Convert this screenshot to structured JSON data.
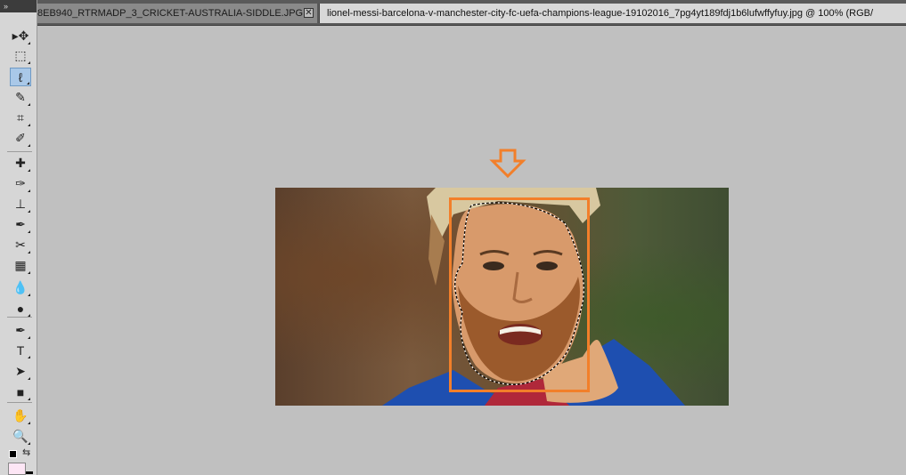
{
  "tabs": [
    {
      "label": "8EB940_RTRMADP_3_CRICKET-AUSTRALIA-SIDDLE.JPG",
      "close_symbol": "✕"
    },
    {
      "label": "lionel-messi-barcelona-v-manchester-city-fc-uefa-champions-league-19102016_7pg4yt189fdj1b6lufwffyfuy.jpg @ 100% (RGB/"
    }
  ],
  "toolbox": {
    "collapse_label": "»",
    "tools": [
      {
        "name": "move-tool",
        "icon": "move-icon",
        "glyph": "▸✥"
      },
      {
        "name": "marquee-tool",
        "icon": "rectangle-marquee-icon",
        "glyph": "⬚"
      },
      {
        "name": "lasso-tool",
        "icon": "lasso-icon",
        "glyph": "ℓ",
        "active": true
      },
      {
        "name": "quick-selection-tool",
        "icon": "quick-selection-icon",
        "glyph": "✎"
      },
      {
        "name": "crop-tool",
        "icon": "crop-icon",
        "glyph": "⌗"
      },
      {
        "name": "eyedropper-tool",
        "icon": "eyedropper-icon",
        "glyph": "✐"
      },
      {
        "name": "healing-brush-tool",
        "icon": "bandage-icon",
        "glyph": "✚"
      },
      {
        "name": "brush-tool",
        "icon": "brush-icon",
        "glyph": "✑"
      },
      {
        "name": "clone-stamp-tool",
        "icon": "stamp-icon",
        "glyph": "⊥"
      },
      {
        "name": "history-brush-tool",
        "icon": "history-brush-icon",
        "glyph": "✒"
      },
      {
        "name": "eraser-tool",
        "icon": "eraser-icon",
        "glyph": "✂"
      },
      {
        "name": "gradient-tool",
        "icon": "gradient-icon",
        "glyph": "▦"
      },
      {
        "name": "blur-tool",
        "icon": "drop-icon",
        "glyph": "💧"
      },
      {
        "name": "dodge-tool",
        "icon": "dodge-icon",
        "glyph": "●"
      },
      {
        "name": "pen-tool",
        "icon": "pen-icon",
        "glyph": "✒"
      },
      {
        "name": "type-tool",
        "icon": "type-icon",
        "glyph": "T"
      },
      {
        "name": "path-selection-tool",
        "icon": "arrow-icon",
        "glyph": "➤"
      },
      {
        "name": "shape-tool",
        "icon": "rectangle-icon",
        "glyph": "■"
      },
      {
        "name": "hand-tool",
        "icon": "hand-icon",
        "glyph": "✋"
      },
      {
        "name": "zoom-tool",
        "icon": "zoom-icon",
        "glyph": "🔍"
      }
    ],
    "swap_glyph": "⇆"
  },
  "colors": {
    "selection_accent": "#f27f2a",
    "active_tool": "#a9c8e8",
    "canvas_bg": "#c0c0c0",
    "background_swatch": "#fde6f5"
  }
}
